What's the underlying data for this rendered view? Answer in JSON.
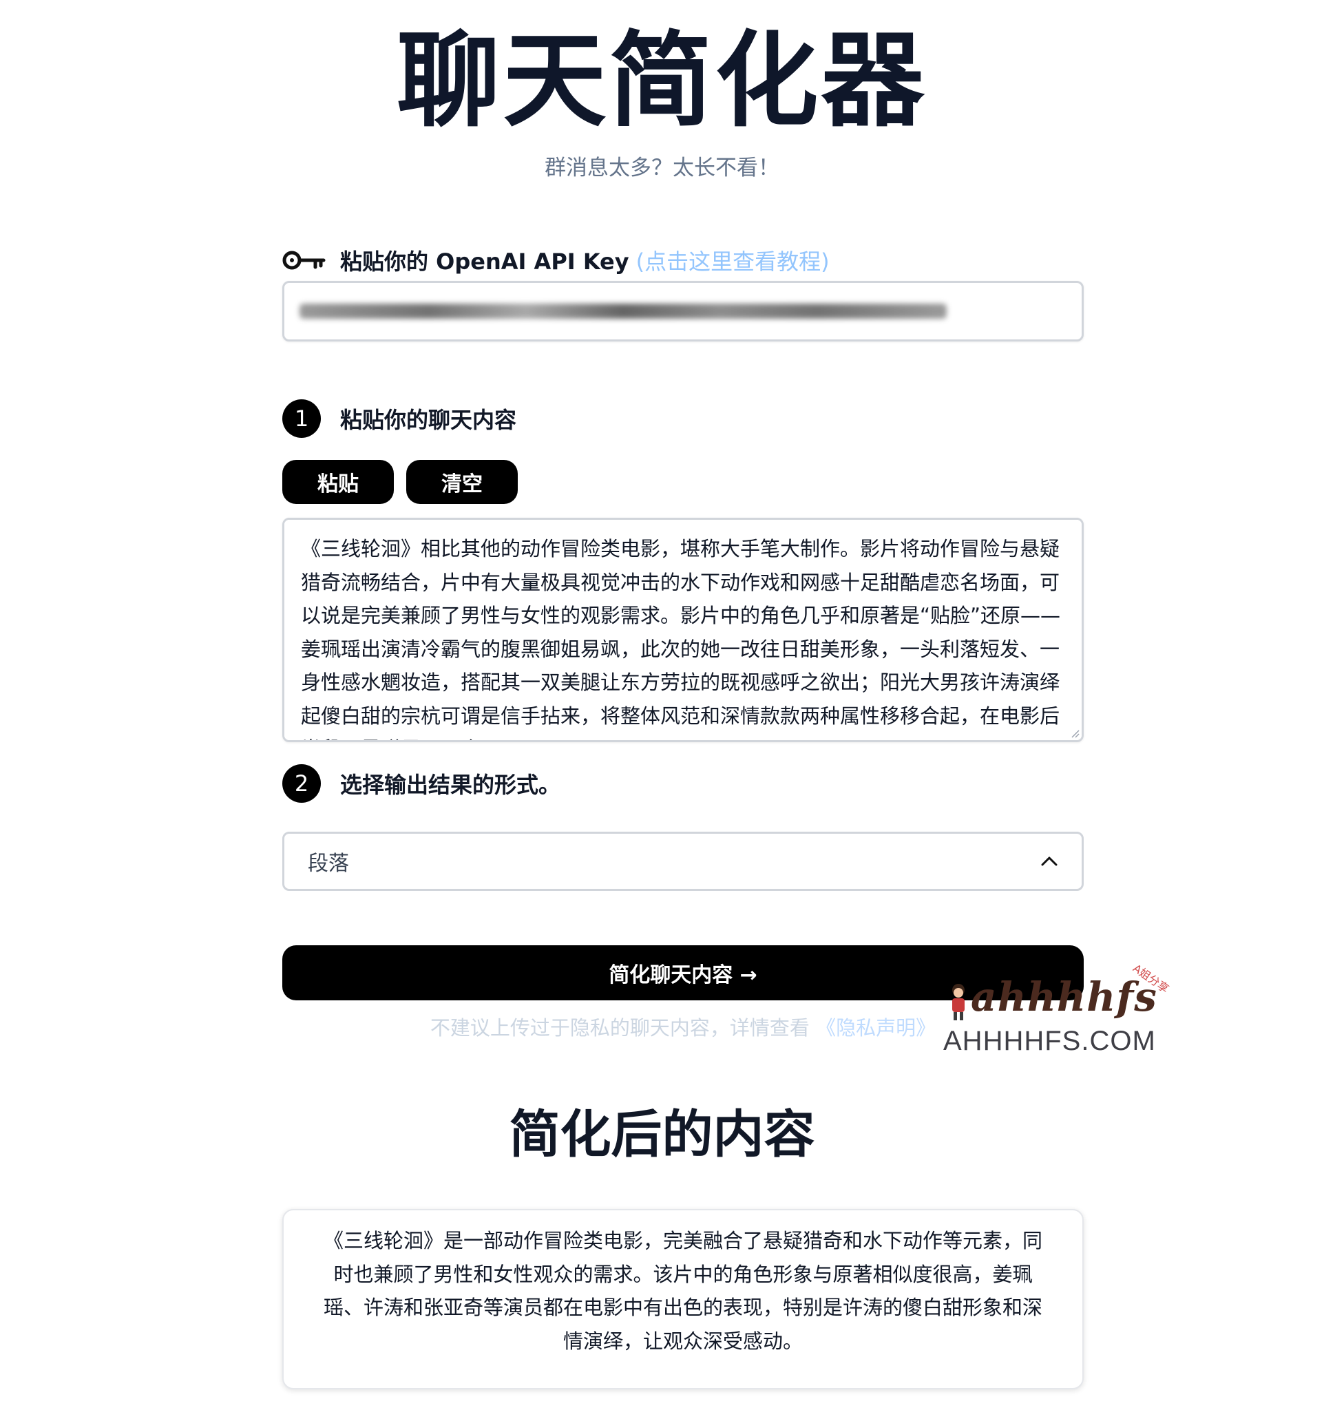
{
  "header": {
    "title": "聊天简化器",
    "subtitle": "群消息太多？太长不看！"
  },
  "api_key": {
    "label": "粘贴你的 OpenAI API Key",
    "tutorial_link": "(点击这里查看教程)",
    "value": ""
  },
  "step1": {
    "number": "1",
    "label": "粘贴你的聊天内容",
    "paste_button": "粘贴",
    "clear_button": "清空",
    "chat_text": "《三线轮洄》相比其他的动作冒险类电影，堪称大手笔大制作。影片将动作冒险与悬疑猎奇流畅结合，片中有大量极具视觉冲击的水下动作戏和网感十足甜酷虐恋名场面，可以说是完美兼顾了男性与女性的观影需求。影片中的角色几乎和原著是“贴脸”还原——姜珮瑶出演清冷霸气的腹黑御姐易飒，此次的她一改往日甜美形象，一头利落短发、一身性感水魍妆造，搭配其一双美腿让东方劳拉的既视感呼之欲出；阳光大男孩许涛演绎起傻白甜的宗杭可谓是信手拈来，将整体风范和深情款款两种属性移移合起，在电影后半段更是赚足了观众"
  },
  "step2": {
    "number": "2",
    "label": "选择输出结果的形式。",
    "selected_format": "段落"
  },
  "submit": {
    "label": "简化聊天内容 →"
  },
  "privacy": {
    "note": "不建议上传过于隐私的聊天内容，详情查看",
    "link": "《隐私声明》"
  },
  "watermark": {
    "script": "ahhhhfs",
    "tag": "A姐分享",
    "domain": "AHHHHFS.COM"
  },
  "result": {
    "title": "简化后的内容",
    "text": "《三线轮洄》是一部动作冒险类电影，完美融合了悬疑猎奇和水下动作等元素，同时也兼顾了男性和女性观众的需求。该片中的角色形象与原著相似度很高，姜珮瑶、许涛和张亚奇等演员都在电影中有出色的表现，特别是许涛的傻白甜形象和深情演绎，让观众深受感动。"
  }
}
